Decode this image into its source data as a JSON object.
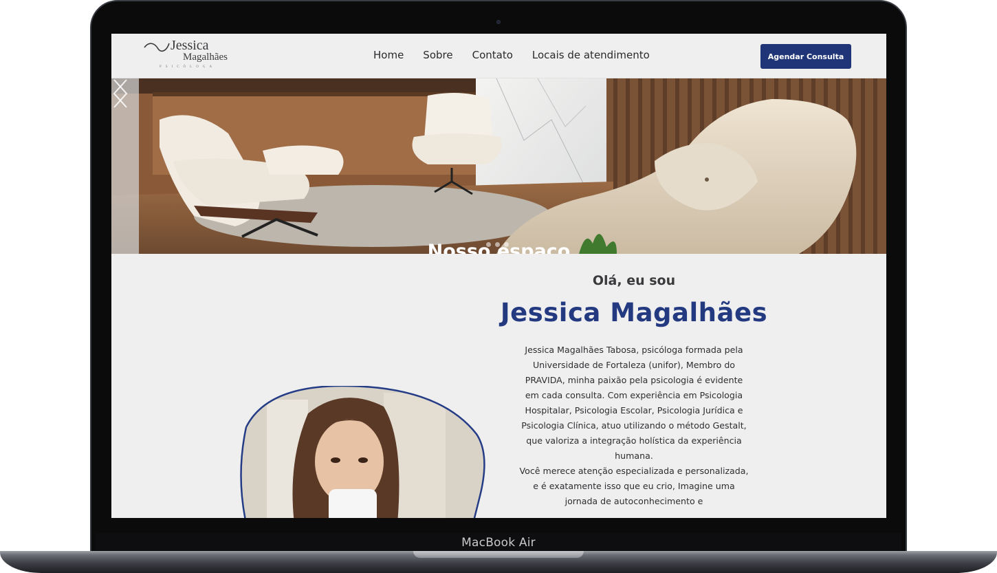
{
  "device": {
    "label": "MacBook Air"
  },
  "logo": {
    "line1": "Jessica",
    "line2": "Magalhães",
    "line3": "PSICÓLOGA"
  },
  "nav": {
    "links": [
      "Home",
      "Sobre",
      "Contato",
      "Locais de atendimento"
    ],
    "cta": "Agendar Consulta"
  },
  "hero": {
    "caption": "Nosso espaço",
    "slide_count": 3
  },
  "about": {
    "greeting": "Olá, eu sou",
    "name": "Jessica Magalhães",
    "paragraphs": [
      "Jessica Magalhães Tabosa, psicóloga formada pela Universidade de Fortaleza (unifor), Membro do PRAVIDA, minha paixão pela psicologia é evidente em cada consulta. Com experiência em Psicologia Hospitalar, Psicologia Escolar, Psicologia Jurídica e Psicologia Clínica, atuo utilizando o método Gestalt, que valoriza a integração holística da experiência humana.",
      "Você merece atenção especializada e personalizada, e é exatamente isso que eu crio, Imagine uma jornada de autoconhecimento e"
    ]
  },
  "colors": {
    "brand_blue": "#1f3578",
    "name_blue": "#233a80",
    "page_bg": "#efeff0"
  }
}
